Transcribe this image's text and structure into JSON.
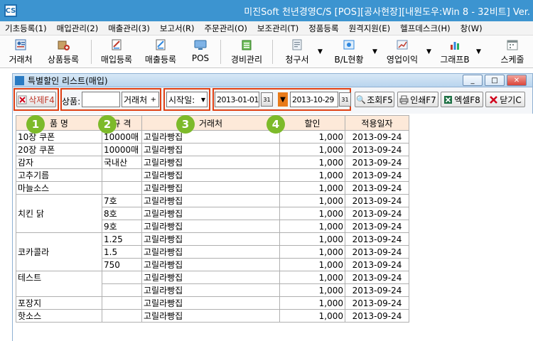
{
  "window": {
    "title": "미진Soft 천년경영C/S [POS][공사현장][내원도우:Win 8 - 32비트] Ver.",
    "app_icon": "CS"
  },
  "menu": [
    "기초등록(1)",
    "매입관리(2)",
    "매출관리(3)",
    "보고서(R)",
    "주문관리(O)",
    "보조관리(T)",
    "정품등록",
    "원격지원(E)",
    "헬프데스크(H)",
    "창(W)"
  ],
  "toolbar": [
    {
      "label": "거래처",
      "icon": "customer-icon",
      "color": "#3a6fb0"
    },
    {
      "label": "상품등록",
      "icon": "product-icon",
      "color": "#c0392b"
    },
    {
      "label": "매입등록",
      "icon": "purchase-icon",
      "color": "#c0392b"
    },
    {
      "label": "매출등록",
      "icon": "sales-icon",
      "color": "#2e86de"
    },
    {
      "label": "POS",
      "icon": "pos-icon",
      "color": "#2e86de"
    },
    {
      "label": "경비관리",
      "icon": "expense-icon",
      "color": "#27ae60"
    },
    {
      "label": "청구서",
      "icon": "invoice-icon",
      "color": "#8e9ba8"
    },
    {
      "label": "B/L현황",
      "icon": "bl-icon",
      "color": "#2e86de"
    },
    {
      "label": "영업이익",
      "icon": "profit-icon",
      "color": "#6c8eb5"
    },
    {
      "label": "그래프B",
      "icon": "chart-icon",
      "color": "#c0392b"
    },
    {
      "label": "스케줄",
      "icon": "calendar-icon",
      "color": "#7f8c8d"
    }
  ],
  "subwindow": {
    "title": "특별할인 리스트(매입)",
    "buttons": [
      "_",
      "□",
      "✕"
    ]
  },
  "filter": {
    "delete_label": "삭제F4",
    "product_label": "상품:",
    "product_value": "",
    "customer_button": "거래처",
    "date_type": "시작일:",
    "date_from": "2013-01-01",
    "date_to": "2013-10-29",
    "calendar_glyph": "31",
    "search_label": "조회F5",
    "print_label": "인쇄F7",
    "excel_label": "엑셀F8",
    "close_label": "닫기C"
  },
  "badges": [
    "1",
    "2",
    "3",
    "4"
  ],
  "grid": {
    "headers": [
      "품  명",
      "규  격",
      "거래처",
      "할인",
      "적용일자"
    ],
    "rows": [
      [
        "10장 쿠폰",
        "10000매",
        "고릴라빵집",
        "1,000",
        "2013-09-24"
      ],
      [
        "20장 쿠폰",
        "10000매",
        "고릴라빵집",
        "1,000",
        "2013-09-24"
      ],
      [
        "감자",
        "국내산",
        "고릴라빵집",
        "1,000",
        "2013-09-24"
      ],
      [
        "고추기름",
        "",
        "고릴라빵집",
        "1,000",
        "2013-09-24"
      ],
      [
        "마늘소스",
        "",
        "고릴라빵집",
        "1,000",
        "2013-09-24"
      ],
      [
        "",
        "7호",
        "고릴라빵집",
        "1,000",
        "2013-09-24"
      ],
      [
        "치킨 닭",
        "8호",
        "고릴라빵집",
        "1,000",
        "2013-09-24"
      ],
      [
        "",
        "9호",
        "고릴라빵집",
        "1,000",
        "2013-09-24"
      ],
      [
        "",
        "1.25",
        "고릴라빵집",
        "1,000",
        "2013-09-24"
      ],
      [
        "코카콜라",
        "1.5",
        "고릴라빵집",
        "1,000",
        "2013-09-24"
      ],
      [
        "",
        "750",
        "고릴라빵집",
        "1,000",
        "2013-09-24"
      ],
      [
        "테스트",
        "",
        "고릴라빵집",
        "1,000",
        "2013-09-24"
      ],
      [
        "",
        "",
        "고릴라빵집",
        "1,000",
        "2013-09-24"
      ],
      [
        "포장지",
        "",
        "고릴라빵집",
        "1,000",
        "2013-09-24"
      ],
      [
        "핫소스",
        "",
        "고릴라빵집",
        "1,000",
        "2013-09-24"
      ]
    ]
  },
  "colors": {
    "titlebar": "#3c94d0",
    "highlight_box": "#e04014",
    "badge": "#7dba2a",
    "header_bg": "#fde9d9"
  }
}
